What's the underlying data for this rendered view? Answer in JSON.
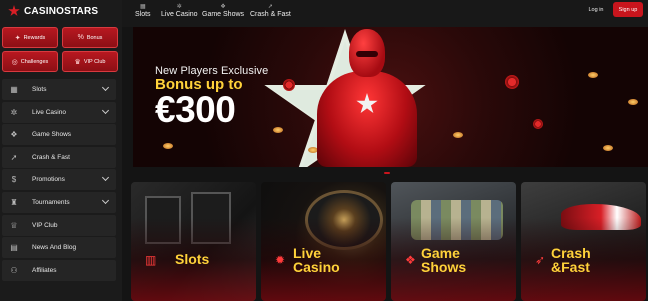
{
  "brand": {
    "name": "CASINOSTARS",
    "accent": "#c8151d",
    "highlight": "#ffd23a"
  },
  "quick_pills": [
    {
      "label": "Rewards",
      "icon": "gift-icon"
    },
    {
      "label": "Bonus",
      "icon": "percent-icon"
    },
    {
      "label": "Challenges",
      "icon": "target-icon"
    },
    {
      "label": "VIP Club",
      "icon": "crown-icon"
    }
  ],
  "sidebar": {
    "items": [
      {
        "label": "Slots",
        "icon": "slots-icon",
        "expandable": true
      },
      {
        "label": "Live Casino",
        "icon": "live-casino-icon",
        "expandable": true
      },
      {
        "label": "Game Shows",
        "icon": "game-shows-icon",
        "expandable": false
      },
      {
        "label": "Crash & Fast",
        "icon": "crash-icon",
        "expandable": false
      },
      {
        "label": "Promotions",
        "icon": "promotions-icon",
        "expandable": true
      },
      {
        "label": "Tournaments",
        "icon": "trophy-icon",
        "expandable": true
      },
      {
        "label": "VIP Club",
        "icon": "vip-icon",
        "expandable": false
      },
      {
        "label": "News And Blog",
        "icon": "news-icon",
        "expandable": false
      },
      {
        "label": "Affiliates",
        "icon": "affiliates-icon",
        "expandable": false
      }
    ]
  },
  "topnav": {
    "items": [
      {
        "label": "Slots",
        "icon": "slots-icon"
      },
      {
        "label": "Live Casino",
        "icon": "live-casino-icon"
      },
      {
        "label": "Game Shows",
        "icon": "game-shows-icon"
      },
      {
        "label": "Crash & Fast",
        "icon": "crash-icon"
      }
    ],
    "login_label": "Log in",
    "signup_label": "Sign up"
  },
  "banner": {
    "line1": "New Players Exclusive",
    "line2": "Bonus up to",
    "line3": "€300"
  },
  "cards": [
    {
      "line1": "Slots",
      "line2": "",
      "icon": "slots-icon"
    },
    {
      "line1": "Live",
      "line2": "Casino",
      "icon": "roulette-icon"
    },
    {
      "line1": "Game",
      "line2": "Shows",
      "icon": "game-shows-icon"
    },
    {
      "line1": "Crash",
      "line2": "&Fast",
      "icon": "rocket-icon"
    }
  ]
}
